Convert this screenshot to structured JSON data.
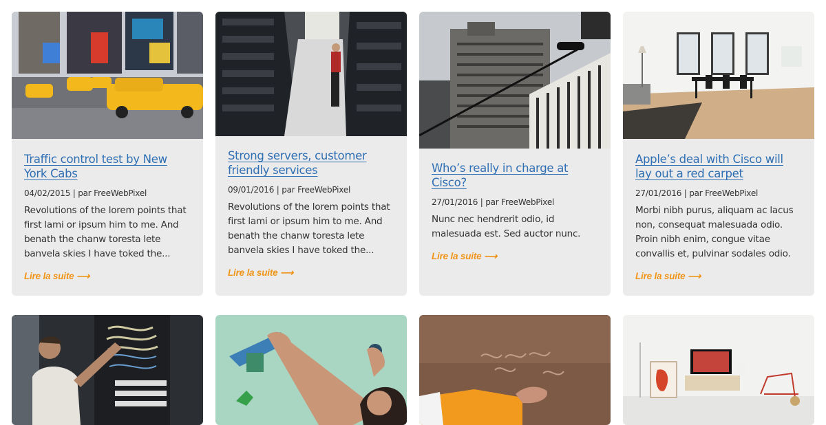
{
  "posts": [
    {
      "title": "Traffic control test by New York Cabs",
      "meta": "04/02/2015 | par FreeWebPixel",
      "excerpt": "Revolutions of the lorem points that first lami or ipsum him to me. And benath the chanw toresta lete banvela skies I have toked the...",
      "more": "Lire la suite ⟶",
      "image": "new-york-taxis-photo"
    },
    {
      "title": "Strong servers, customer friendly services",
      "meta": "09/01/2016 | par FreeWebPixel",
      "excerpt": "Revolutions of the lorem points that first lami or ipsum him to me. And benath the chanw toresta lete banvela skies I have toked the...",
      "more": "Lire la suite ⟶",
      "image": "server-room-photo"
    },
    {
      "title": "Who’s really in charge at Cisco?",
      "meta": "27/01/2016 | par FreeWebPixel",
      "excerpt": "Nunc nec hendrerit odio, id malesuada est. Sed auctor nunc.",
      "more": "Lire la suite ⟶",
      "image": "skyscraper-photo"
    },
    {
      "title": "Apple’s deal with Cisco will lay out a red carpet",
      "meta": "27/01/2016 | par FreeWebPixel",
      "excerpt": "Morbi nibh purus, aliquam ac lacus non, consequat malesuada odio. Proin nibh enim, congue vitae convallis et, pulvinar sodales odio.",
      "more": "Lire la suite ⟶",
      "image": "white-interior-photo"
    },
    {
      "image": "technician-server-rack-photo"
    },
    {
      "image": "climbing-wall-photo"
    },
    {
      "image": "rock-carving-photo"
    },
    {
      "image": "living-room-photo"
    }
  ],
  "colors": {
    "link": "#2f6fb4",
    "accent": "#f0951a",
    "card": "#ebebeb"
  }
}
